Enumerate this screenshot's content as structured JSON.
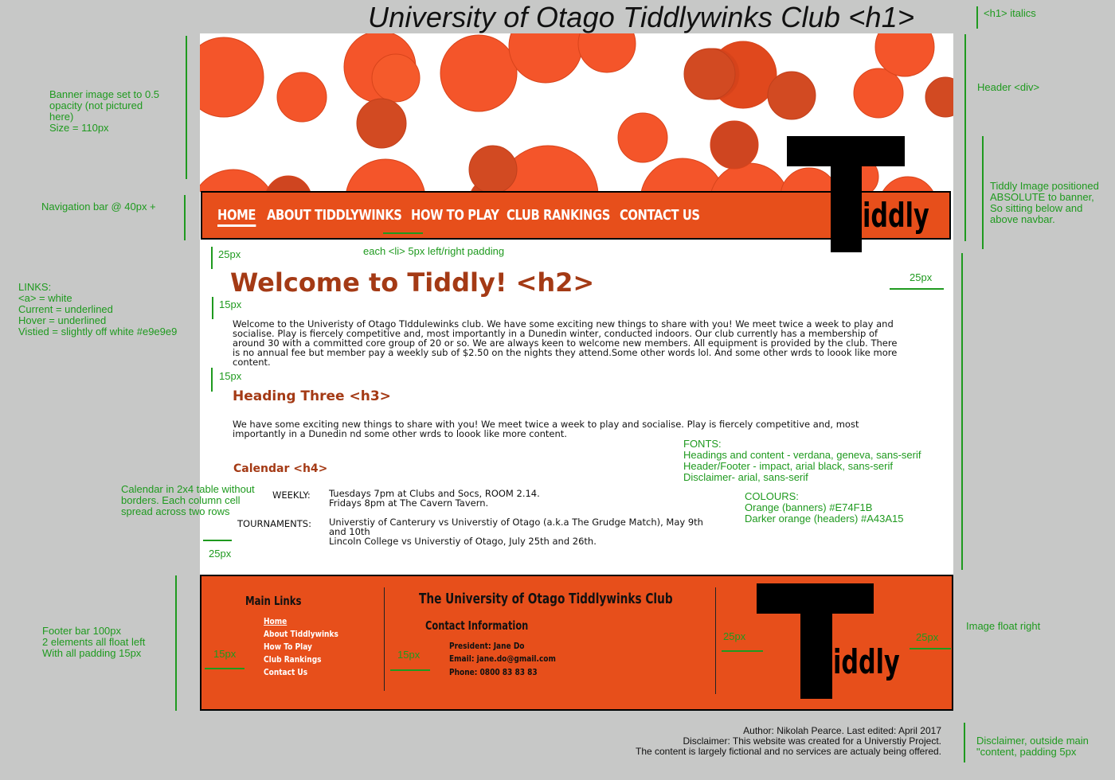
{
  "header": {
    "title": "University of Otago Tiddlywinks Club <h1>",
    "logo_text": "iddly"
  },
  "nav": {
    "items": [
      {
        "label": "HOME",
        "current": true
      },
      {
        "label": "ABOUT TIDDLYWINKS"
      },
      {
        "label": "HOW TO PLAY"
      },
      {
        "label": "CLUB RANKINGS"
      },
      {
        "label": "CONTACT US"
      }
    ]
  },
  "content": {
    "h2": "Welcome to Tiddly! <h2>",
    "intro": "Welcome to the Univeristy of Otago TIddulewinks club. We have some exciting new things to share with you!  We meet twice a week to play and socialise. Play is fiercely competitive and, most importantly in a Dunedin winter, conducted indoors. Our club currently has a membership of around 30 with a committed core group of 20 or so. We are always keen to welcome new members. All equipment is provided by the club. There is no annual fee but member pay a weekly sub of $2.50 on the nights they attend.Some other words lol. And  some other wrds to loook like more content.",
    "h3": "Heading Three <h3>",
    "para2": "We have some exciting new things to share with you!  We meet twice a week to play and socialise. Play is fiercely competitive and, most importantly in a Dunedin nd some other wrds to loook like more content.",
    "h4": "Calendar <h4>",
    "calendar": [
      {
        "label": "WEEKLY:",
        "lines": [
          "Tuesdays 7pm at Clubs and Socs, ROOM 2.14.",
          "Fridays 8pm at The Cavern Tavern."
        ]
      },
      {
        "label": "TOURNAMENTS:",
        "lines": [
          "Universtiy of Canterury vs Universtiy of Otago (a.k.a The Grudge Match), May 9th and 10th",
          "Lincoln College vs Universtiy of Otago, July 25th and 26th."
        ]
      }
    ]
  },
  "footer": {
    "main_links_heading": "Main Links",
    "links": [
      "Home",
      "About Tiddlywinks",
      "How To Play",
      "Club Rankings",
      "Contact Us"
    ],
    "club_title": "The University of Otago Tiddlywinks Club",
    "contact_heading": "Contact Information",
    "contact_lines": [
      "President: Jane Do",
      "Email: jane.do@gmail.com",
      "Phone: 0800 83 83 83"
    ],
    "logo_text": "iddly"
  },
  "disclaimer": {
    "lines": [
      "Author: Nikolah Pearce. Last edited: April 2017",
      "Disclaimer: This website was created for a Universtiy Project.",
      "The content is largely fictional and no services are actualy being offered."
    ]
  },
  "annotations": {
    "h1_note": "<h1> italics",
    "header_div": "Header <div>",
    "banner_note": "Banner image set to 0.5\nopacity (not pictured\nhere)\nSize  = 110px",
    "tiddly_note": "Tiddly Image positioned\nABSOLUTE to banner,\nSo sitting below and\nabove navbar.",
    "navbar_note": "Navigation bar @ 40px +",
    "li_padding": "each <li> 5px left/right padding",
    "px25_a": "25px",
    "px25_b": "25px",
    "px15_a": "15px",
    "px15_b": "15px",
    "links_note": "LINKS:\n<a> = white\n Current = underlined\nHover = underlined\nVistied = slightly off white #e9e9e9",
    "fonts_note": "FONTS:\nHeadings and content -  verdana, geneva, sans-serif\nHeader/Footer -  impact, arial black, sans-serif\nDisclaimer- arial, sans-serif",
    "colours_note": "COLOURS:\nOrange (banners) #E74F1B\nDarker orange (headers) #A43A15",
    "calendar_note": "Calendar in 2x4 table without\nborders. Each column cell\nspread across two rows",
    "px25_c": "25px",
    "footer_note": "Footer bar 100px\n2 elements all float left\nWith all padding 15px",
    "footer_15a": "15px",
    "footer_15b": "15px",
    "footer_25a": "25px",
    "footer_25b": "25px",
    "image_float": "Image float right",
    "disclaimer_note": "Disclaimer, outside main\n\"content, padding 5px"
  },
  "colors": {
    "banner_orange": "#E74F1B",
    "header_dark_orange": "#A43A15",
    "annotation_green": "#1f9a1f",
    "page_background": "#c7c8c7"
  }
}
